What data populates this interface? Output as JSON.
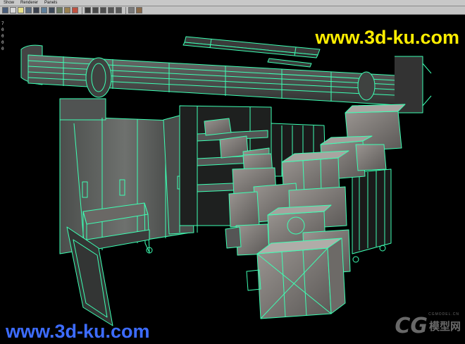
{
  "menubar": {
    "items": [
      "Show",
      "Renderer",
      "Panels"
    ]
  },
  "toolbar": {
    "icons": [
      {
        "name": "camera-icon",
        "color": "#4a5d7a"
      },
      {
        "name": "sphere-icon",
        "color": "#d8d8d8"
      },
      {
        "name": "light-bulb-icon",
        "color": "#e8e08a"
      },
      {
        "name": "cube-icon",
        "color": "#5a6a80"
      },
      {
        "name": "smooth-shade-icon",
        "color": "#3d4350"
      },
      {
        "name": "textured-icon",
        "color": "#5f7f9a"
      },
      {
        "name": "grid-icon",
        "color": "#3f4a5a"
      },
      {
        "name": "shadow-icon",
        "color": "#6a7a60"
      },
      {
        "name": "isolate-icon",
        "color": "#9a8050"
      },
      {
        "name": "xray-icon",
        "color": "#c05040"
      },
      {
        "name": "hud-icon",
        "color": "#3a3a3a"
      },
      {
        "name": "resolution-gate-icon",
        "color": "#4a4a4a"
      },
      {
        "name": "film-gate-icon",
        "color": "#4f4f4f"
      },
      {
        "name": "safe-action-icon",
        "color": "#555"
      },
      {
        "name": "field-chart-icon",
        "color": "#5a5a5a"
      },
      {
        "name": "bookmark-icon",
        "color": "#7a7a7a"
      },
      {
        "name": "gamma-icon",
        "color": "#8a6a4a"
      }
    ]
  },
  "viewport": {
    "stats": [
      "7",
      "0",
      "0",
      "0",
      "0"
    ],
    "wireframe_color": "#3dffb3",
    "background": "#000000"
  },
  "watermarks": {
    "top": "www.3d-ku.com",
    "bottom": "www.3d-ku.com",
    "top_color": "#ffee00",
    "bottom_color": "#3d6cff"
  },
  "logo": {
    "cg": "CG",
    "cn": "模型网",
    "site": "CGMODEL.CN"
  }
}
